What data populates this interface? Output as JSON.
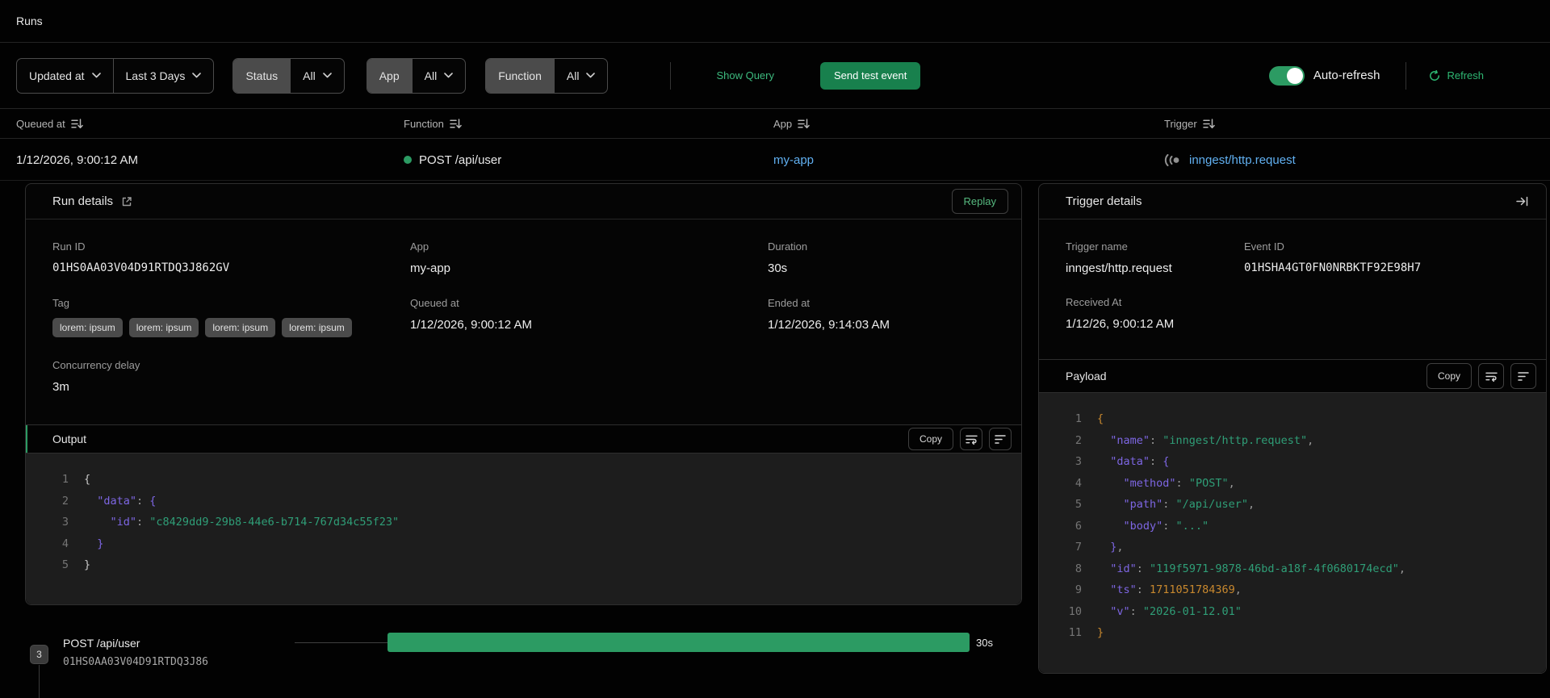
{
  "page": {
    "title": "Runs"
  },
  "filters": {
    "time_field": "Updated at",
    "time_range": "Last 3 Days",
    "status": {
      "label": "Status",
      "value": "All"
    },
    "app": {
      "label": "App",
      "value": "All"
    },
    "function": {
      "label": "Function",
      "value": "All"
    },
    "show_query": "Show Query",
    "send_test_event": "Send test event",
    "auto_refresh_label": "Auto-refresh",
    "auto_refresh_on": true,
    "refresh_label": "Refresh"
  },
  "table": {
    "columns": {
      "queued_at": "Queued at",
      "function": "Function",
      "app": "App",
      "trigger": "Trigger"
    },
    "row": {
      "queued_at": "1/12/2026, 9:00:12 AM",
      "function": "POST /api/user",
      "status_color": "#2c9b63",
      "app": "my-app",
      "trigger": "inngest/http.request"
    }
  },
  "run_details": {
    "title": "Run details",
    "replay_label": "Replay",
    "run_id": {
      "label": "Run ID",
      "value": "01HS0AA03V04D91RTDQ3J862GV"
    },
    "app": {
      "label": "App",
      "value": "my-app"
    },
    "duration": {
      "label": "Duration",
      "value": "30s"
    },
    "tag": {
      "label": "Tag",
      "badges": [
        "lorem: ipsum",
        "lorem: ipsum",
        "lorem: ipsum",
        "lorem: ipsum"
      ]
    },
    "queued_at": {
      "label": "Queued at",
      "value": "1/12/2026, 9:00:12 AM"
    },
    "ended_at": {
      "label": "Ended at",
      "value": "1/12/2026, 9:14:03 AM"
    },
    "concurrency_delay": {
      "label": "Concurrency delay",
      "value": "3m"
    },
    "output": {
      "title": "Output",
      "copy_label": "Copy",
      "lines": [
        [
          {
            "c": "plain",
            "t": "{"
          }
        ],
        [
          {
            "c": "key",
            "t": "  \"data\""
          },
          {
            "c": "punc",
            "t": ": "
          },
          {
            "c": "purple",
            "t": "{"
          }
        ],
        [
          {
            "c": "key",
            "t": "    \"id\""
          },
          {
            "c": "punc",
            "t": ": "
          },
          {
            "c": "str",
            "t": "\"c8429dd9-29b8-44e6-b714-767d34c55f23\""
          }
        ],
        [
          {
            "c": "purple",
            "t": "  }"
          }
        ],
        [
          {
            "c": "plain",
            "t": "}"
          }
        ]
      ]
    }
  },
  "trigger_details": {
    "title": "Trigger details",
    "trigger_name": {
      "label": "Trigger name",
      "value": "inngest/http.request"
    },
    "event_id": {
      "label": "Event ID",
      "value": "01HSHA4GT0FN0NRBKTF92E98H7"
    },
    "received_at": {
      "label": "Received At",
      "value": "1/12/26, 9:00:12 AM"
    },
    "payload": {
      "title": "Payload",
      "copy_label": "Copy",
      "lines": [
        [
          {
            "c": "num",
            "t": "{"
          }
        ],
        [
          {
            "c": "key",
            "t": "  \"name\""
          },
          {
            "c": "punc",
            "t": ": "
          },
          {
            "c": "str",
            "t": "\"inngest/http.request\""
          },
          {
            "c": "punc",
            "t": ","
          }
        ],
        [
          {
            "c": "key",
            "t": "  \"data\""
          },
          {
            "c": "punc",
            "t": ": "
          },
          {
            "c": "purple",
            "t": "{"
          }
        ],
        [
          {
            "c": "key",
            "t": "    \"method\""
          },
          {
            "c": "punc",
            "t": ": "
          },
          {
            "c": "str",
            "t": "\"POST\""
          },
          {
            "c": "punc",
            "t": ","
          }
        ],
        [
          {
            "c": "key",
            "t": "    \"path\""
          },
          {
            "c": "punc",
            "t": ": "
          },
          {
            "c": "str",
            "t": "\"/api/user\""
          },
          {
            "c": "punc",
            "t": ","
          }
        ],
        [
          {
            "c": "key",
            "t": "    \"body\""
          },
          {
            "c": "punc",
            "t": ": "
          },
          {
            "c": "str",
            "t": "\"...\""
          }
        ],
        [
          {
            "c": "purple",
            "t": "  }"
          },
          {
            "c": "punc",
            "t": ","
          }
        ],
        [
          {
            "c": "key",
            "t": "  \"id\""
          },
          {
            "c": "punc",
            "t": ": "
          },
          {
            "c": "str",
            "t": "\"119f5971-9878-46bd-a18f-4f0680174ecd\""
          },
          {
            "c": "punc",
            "t": ","
          }
        ],
        [
          {
            "c": "key",
            "t": "  \"ts\""
          },
          {
            "c": "punc",
            "t": ": "
          },
          {
            "c": "num",
            "t": "1711051784369"
          },
          {
            "c": "punc",
            "t": ","
          }
        ],
        [
          {
            "c": "key",
            "t": "  \"v\""
          },
          {
            "c": "punc",
            "t": ": "
          },
          {
            "c": "str",
            "t": "\"2026-01-12.01\""
          }
        ],
        [
          {
            "c": "num",
            "t": "}"
          }
        ]
      ]
    }
  },
  "timeline": {
    "step_count": "3",
    "function_name": "POST /api/user",
    "run_id": "01HS0AA03V04D91RTDQ3J86",
    "duration": "30s"
  },
  "colors": {
    "accent_green": "#2c9b63",
    "button_green": "#18804d",
    "link_blue": "#61b0f1",
    "link_green": "#3dba7e",
    "code_key_purple": "#7d66e3",
    "code_string_green": "#2f9e77",
    "code_number_orange": "#c8882e",
    "code_background": "#1d1d1d"
  }
}
